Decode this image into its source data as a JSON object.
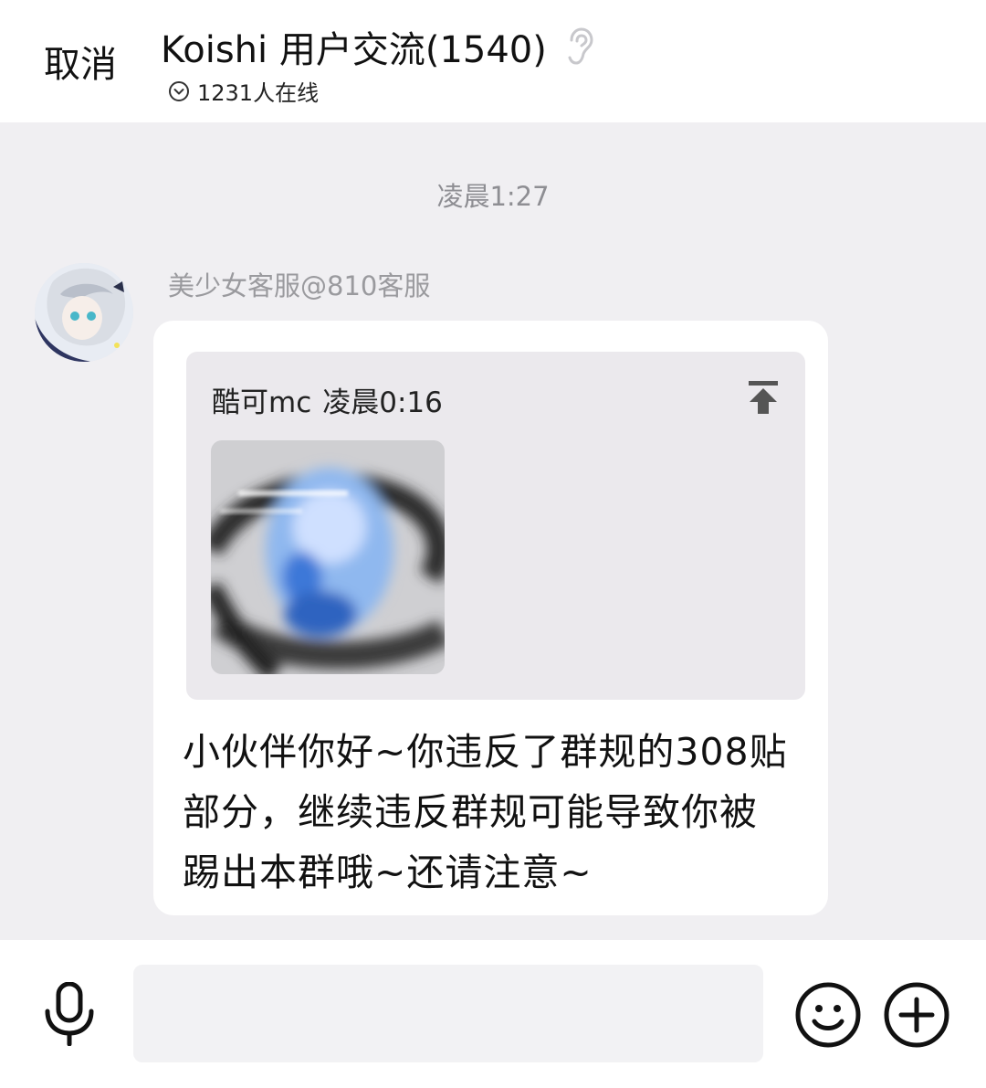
{
  "header": {
    "cancel_label": "取消",
    "group_title": "Koishi 用户交流(1540)",
    "online_status": "1231人在线",
    "icons": {
      "ear": "ear-icon",
      "online": "chevron-down-circle-icon"
    }
  },
  "chat": {
    "time_divider": "凌晨1:27",
    "messages": [
      {
        "sender": "美少女客服@810客服",
        "quote": {
          "author": "酷可mc",
          "time": "凌晨0:16",
          "icon": "jump-to-original-icon"
        },
        "text": "小伙伴你好~你违反了群规的308贴部分，继续违反群规可能导致你被踢出本群哦~还请注意~"
      }
    ]
  },
  "footer": {
    "input_placeholder": "",
    "icons": {
      "mic": "microphone-icon",
      "emoji": "emoji-icon",
      "more": "plus-icon"
    }
  },
  "colors": {
    "background": "#f0eff2",
    "bubble": "#ffffff",
    "quote_card": "#ebe9ed",
    "muted_text": "#8e8e93"
  }
}
